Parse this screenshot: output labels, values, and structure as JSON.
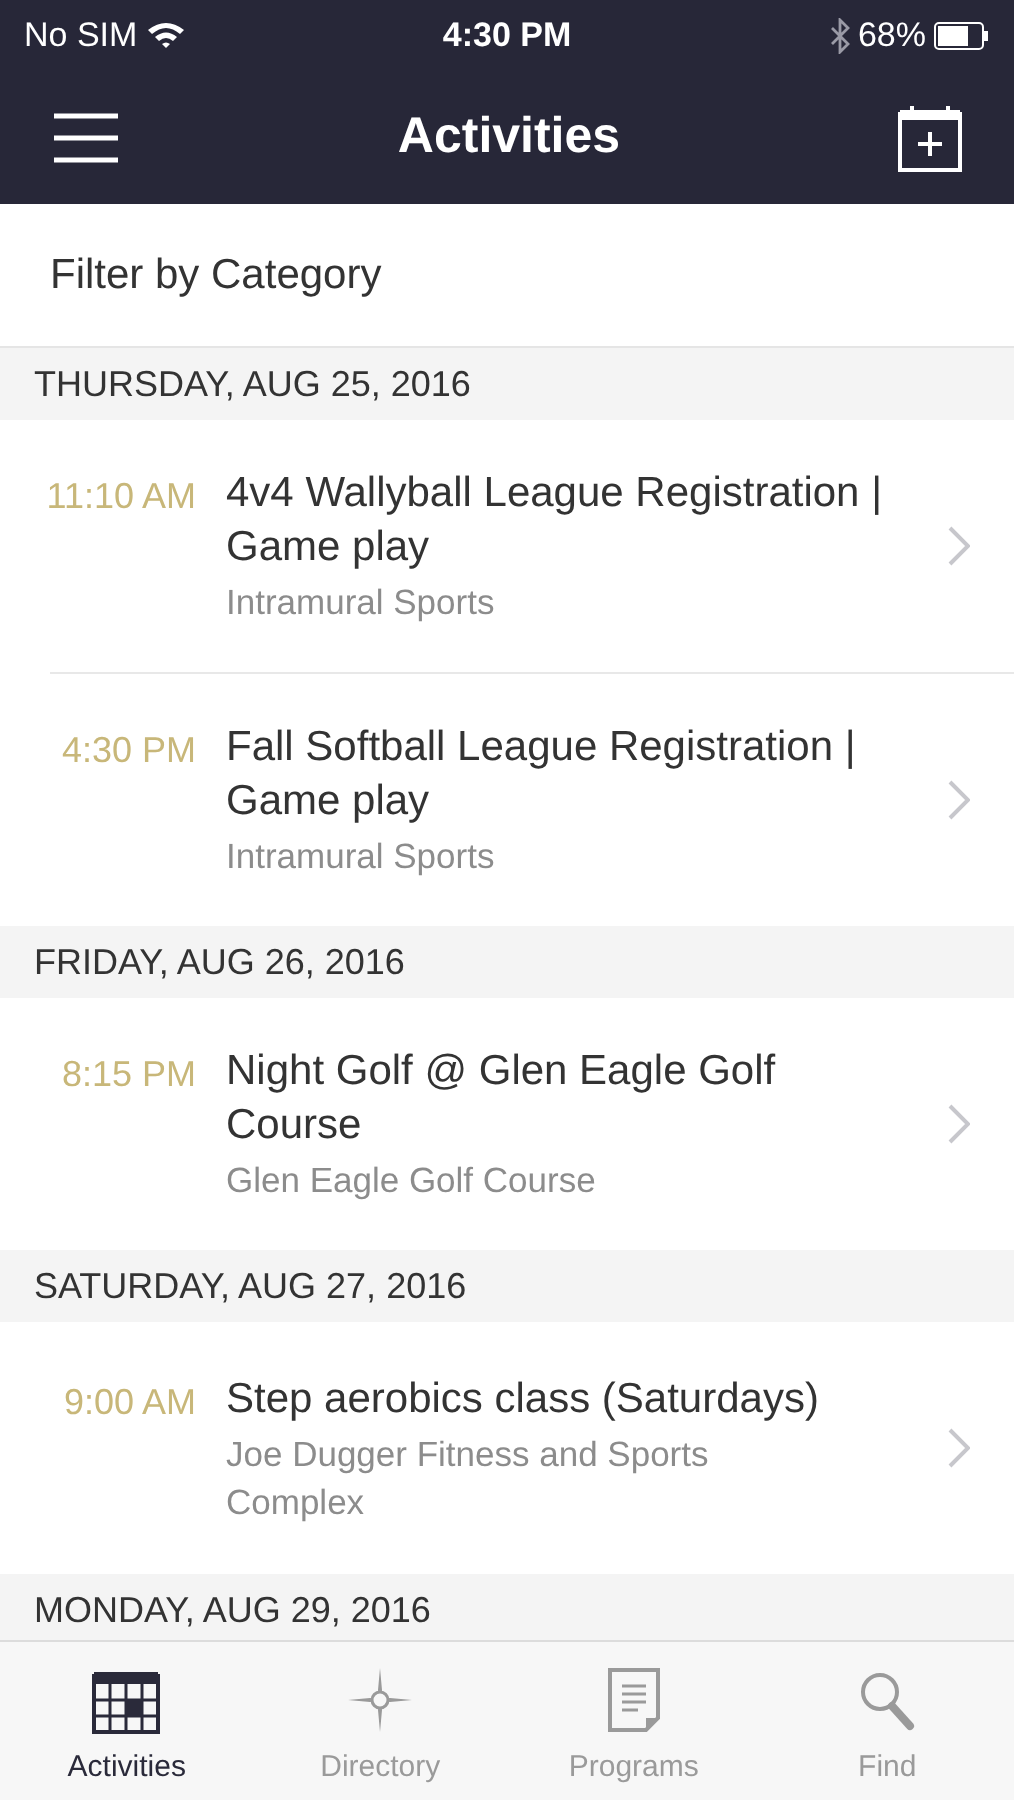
{
  "status_bar": {
    "carrier": "No SIM",
    "time": "4:30 PM",
    "battery": "68%"
  },
  "header": {
    "title": "Activities"
  },
  "filter": {
    "label": "Filter by Category"
  },
  "days": [
    {
      "date": "THURSDAY, AUG 25, 2016",
      "events": [
        {
          "time": "11:10 AM",
          "title": "4v4 Wallyball League Registration | Game play",
          "location": "Intramural Sports"
        },
        {
          "time": "4:30 PM",
          "title": "Fall Softball League Registration | Game play",
          "location": "Intramural Sports"
        }
      ]
    },
    {
      "date": "FRIDAY, AUG 26, 2016",
      "events": [
        {
          "time": "8:15 PM",
          "title": "Night Golf @ Glen Eagle Golf Course",
          "location": "Glen Eagle Golf Course"
        }
      ]
    },
    {
      "date": "SATURDAY, AUG 27, 2016",
      "events": [
        {
          "time": "9:00 AM",
          "title": "Step aerobics class (Saturdays)",
          "location": "Joe Dugger Fitness and Sports Complex"
        }
      ]
    },
    {
      "date": "MONDAY, AUG 29, 2016"
    }
  ],
  "tabs": [
    {
      "kind": "calendar",
      "label": "Activities",
      "selected": true
    },
    {
      "kind": "compass",
      "label": "Directory",
      "selected": false
    },
    {
      "kind": "document",
      "label": "Programs",
      "selected": false
    },
    {
      "kind": "search",
      "label": "Find",
      "selected": false
    }
  ]
}
